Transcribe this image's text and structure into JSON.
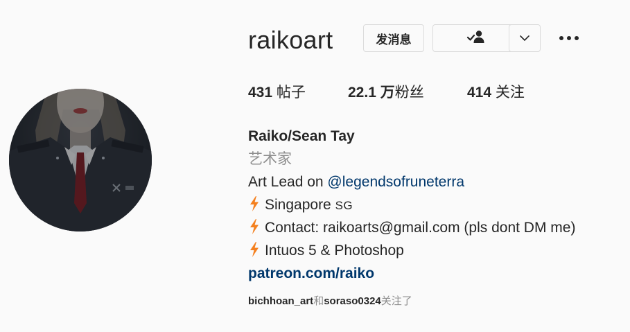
{
  "profile": {
    "username": "raikoart",
    "message_label": "发消息",
    "stats": {
      "posts_count": "431",
      "posts_label": " 帖子",
      "followers_count": "22.1 万",
      "followers_label": "粉丝",
      "following_count": "414",
      "following_label": " 关注"
    },
    "bio": {
      "full_name": "Raiko/Sean Tay",
      "category": "艺术家",
      "line1_prefix": "Art Lead on ",
      "line1_mention": "@legendsofruneterra",
      "line2_text": "Singapore ",
      "line2_flag": "SG",
      "line3_text": "Contact: raikoarts@gmail.com (pls dont DM me)",
      "line4_text": "Intuos 5 & Photoshop",
      "website": "patreon.com/raiko"
    },
    "followed_by": {
      "user1": "bichhoan_art",
      "joiner": "和",
      "user2": "soraso0324",
      "suffix": "关注了"
    }
  },
  "colors": {
    "background": "#fafafa",
    "text": "#262626",
    "secondary": "#8e8e8e",
    "link": "#00376b",
    "bolt": "#f4801f",
    "border": "#dbdbdb"
  },
  "icons": {
    "following": "person-check-icon",
    "more": "chevron-down-icon",
    "options": "ellipsis-icon",
    "bullet": "lightning-bolt-icon"
  }
}
